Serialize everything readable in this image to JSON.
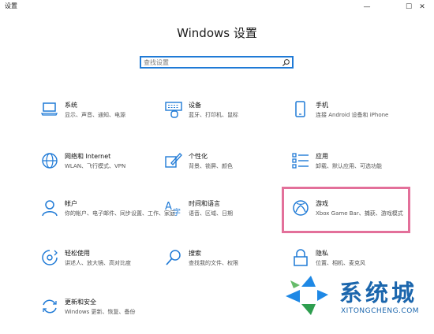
{
  "window": {
    "title": "设置",
    "controls": {
      "minimize": "—",
      "maximize": "☐",
      "close": "✕"
    }
  },
  "header": {
    "title": "Windows 设置"
  },
  "search": {
    "placeholder": "查找设置",
    "value": ""
  },
  "settings": [
    {
      "id": "system",
      "name": "系统",
      "desc": "显示、声音、通知、电源",
      "icon": "laptop-icon"
    },
    {
      "id": "devices",
      "name": "设备",
      "desc": "蓝牙、打印机、鼠标",
      "icon": "keyboard-icon"
    },
    {
      "id": "phone",
      "name": "手机",
      "desc": "连接 Android 设备和 iPhone",
      "icon": "phone-icon"
    },
    {
      "id": "network",
      "name": "网络和 Internet",
      "desc": "WLAN、飞行模式、VPN",
      "icon": "globe-icon"
    },
    {
      "id": "personalization",
      "name": "个性化",
      "desc": "背景、锁屏、颜色",
      "icon": "paint-icon"
    },
    {
      "id": "apps",
      "name": "应用",
      "desc": "卸载、默认应用、可选功能",
      "icon": "apps-list-icon"
    },
    {
      "id": "accounts",
      "name": "帐户",
      "desc": "你的帐户、电子邮件、同步设置、工作、家庭",
      "icon": "person-icon"
    },
    {
      "id": "time",
      "name": "时间和语言",
      "desc": "语音、区域、日期",
      "icon": "time-language-icon"
    },
    {
      "id": "gaming",
      "name": "游戏",
      "desc": "Xbox Game Bar、捕获、游戏模式",
      "icon": "xbox-icon"
    },
    {
      "id": "ease",
      "name": "轻松使用",
      "desc": "讲述人、放大镜、高对比度",
      "icon": "ease-of-access-icon"
    },
    {
      "id": "search",
      "name": "搜索",
      "desc": "查找我的文件、权限",
      "icon": "magnifier-icon"
    },
    {
      "id": "privacy",
      "name": "隐私",
      "desc": "位置、相机、麦克风",
      "icon": "lock-icon"
    },
    {
      "id": "update",
      "name": "更新和安全",
      "desc": "Windows 更新、恢复、备份",
      "icon": "update-icon"
    }
  ],
  "watermark": {
    "text": "系统城",
    "url": "XITONGCHENG.COM"
  },
  "colors": {
    "accent": "#1f7ad6",
    "highlight": "#e3709a",
    "watermark": "#1b66ad"
  }
}
